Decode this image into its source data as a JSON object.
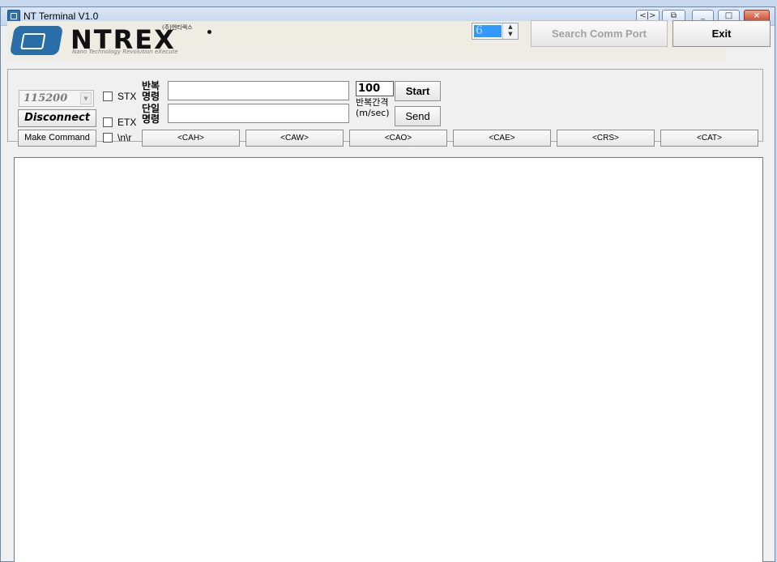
{
  "window": {
    "title": "NT Terminal V1.0",
    "title_buttons": [
      "<|>",
      "⧉",
      "_",
      "□",
      "×"
    ]
  },
  "banner": {
    "logo_small": "(주)엔티렉스",
    "logo_text": "NTREX",
    "logo_subtitle": "Nano Technology Revolution eXecute"
  },
  "port_spin": {
    "value": "6"
  },
  "buttons": {
    "search": "Search Comm Port",
    "exit": "Exit",
    "disconnect": "Disconnect",
    "make_command": "Make Command",
    "start": "Start",
    "send": "Send"
  },
  "baud": {
    "value": "115200"
  },
  "checkboxes": {
    "stx": "STX",
    "etx": "ETX",
    "crlf": "\\n\\r"
  },
  "labels": {
    "repeat_cmd_1": "반복",
    "repeat_cmd_2": "명령",
    "single_cmd_1": "단일",
    "single_cmd_2": "명령",
    "interval_1": "반복간격",
    "interval_2": "(m/sec)"
  },
  "inputs": {
    "repeat_cmd": "",
    "single_cmd": "",
    "interval": "100"
  },
  "commands": [
    "<CAH>",
    "<CAW>",
    "<CAO>",
    "<CAE>",
    "<CRS>",
    "<CAT>"
  ],
  "output": {
    "text": ""
  }
}
